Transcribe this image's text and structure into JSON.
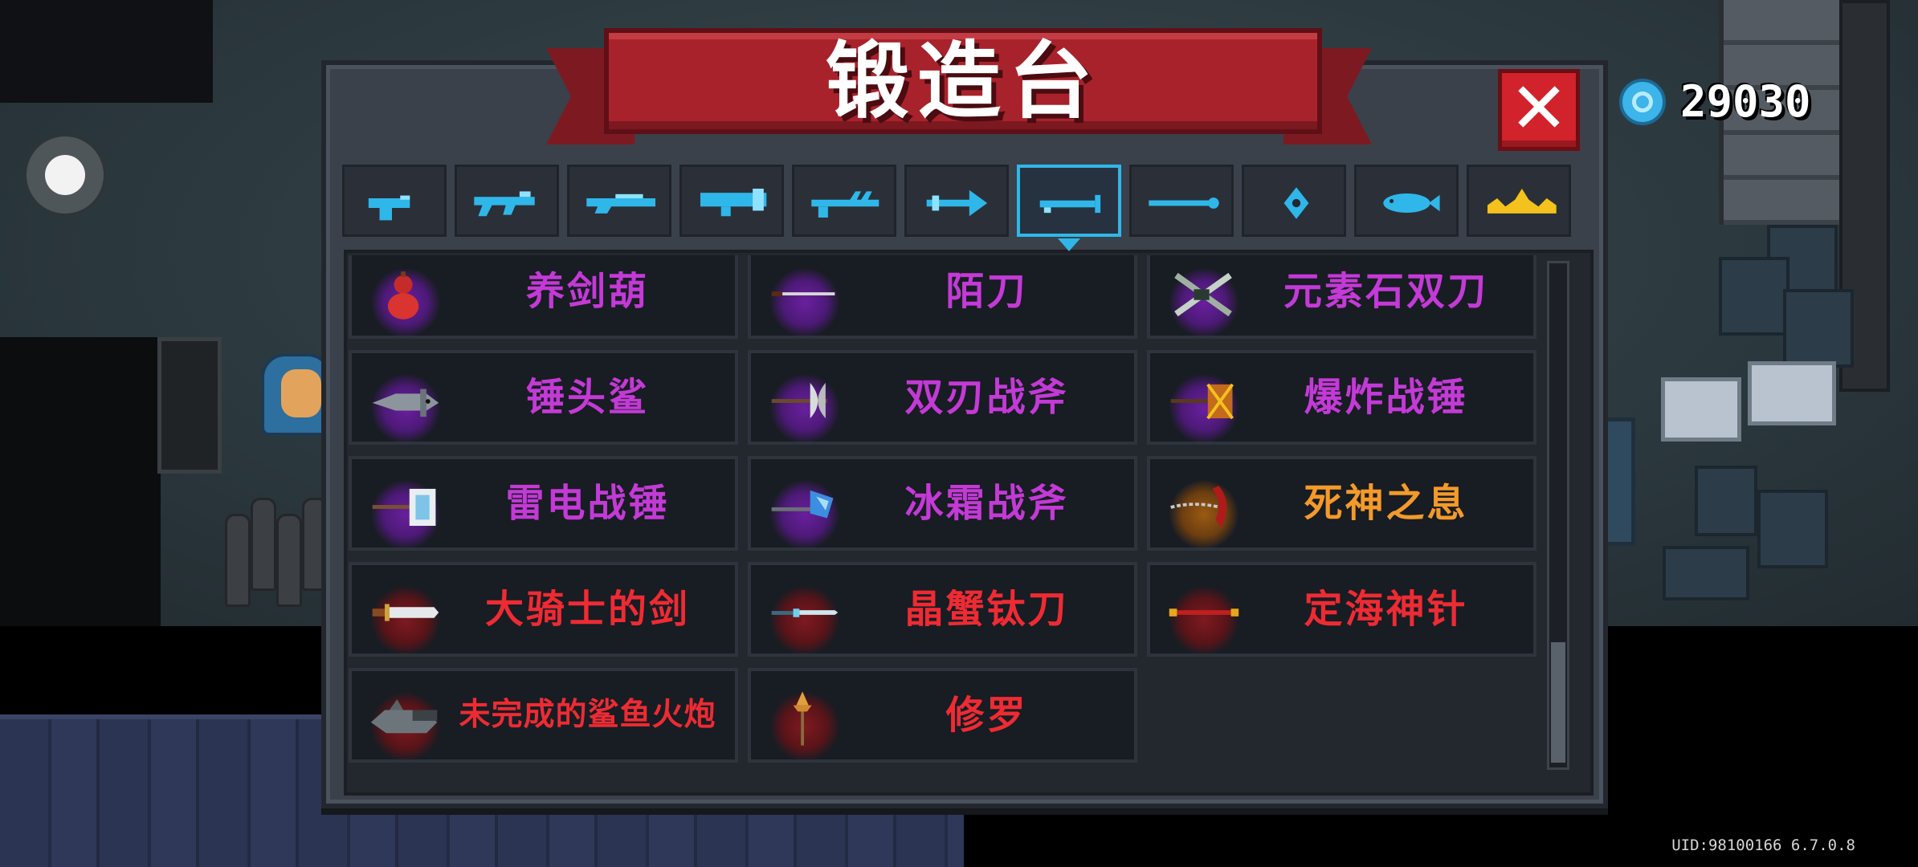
{
  "app": {
    "title": "锻造台",
    "uid_text": "UID:98100166 6.7.0.8"
  },
  "currency": {
    "icon": "gem-icon",
    "value": "29030",
    "color": "#3db4ea"
  },
  "controls": {
    "close_icon": "close-icon",
    "close_label": "✕",
    "joystick": "virtual-joystick"
  },
  "tabs": [
    {
      "icon": "pistol-icon",
      "active": false
    },
    {
      "icon": "assault-rifle-icon",
      "active": false
    },
    {
      "icon": "shotgun-icon",
      "active": false
    },
    {
      "icon": "launcher-icon",
      "active": false
    },
    {
      "icon": "laser-gun-icon",
      "active": false
    },
    {
      "icon": "bow-icon",
      "active": false
    },
    {
      "icon": "melee-sword-icon",
      "active": true
    },
    {
      "icon": "staff-icon",
      "active": false
    },
    {
      "icon": "throwable-icon",
      "active": false
    },
    {
      "icon": "fish-icon",
      "active": false
    },
    {
      "icon": "special-crown-icon",
      "active": false
    }
  ],
  "weapons": [
    {
      "name": "养剑葫",
      "tier": "purple",
      "icon": "gourd-icon"
    },
    {
      "name": "陌刀",
      "tier": "purple",
      "icon": "long-blade-icon"
    },
    {
      "name": "元素石双刀",
      "tier": "purple",
      "icon": "twin-blades-icon"
    },
    {
      "name": "锤头鲨",
      "tier": "purple",
      "icon": "hammerhead-icon"
    },
    {
      "name": "双刃战斧",
      "tier": "purple",
      "icon": "double-axe-icon"
    },
    {
      "name": "爆炸战锤",
      "tier": "purple",
      "icon": "explosive-hammer-icon"
    },
    {
      "name": "雷电战锤",
      "tier": "purple",
      "icon": "thunder-hammer-icon"
    },
    {
      "name": "冰霜战斧",
      "tier": "purple",
      "icon": "frost-axe-icon"
    },
    {
      "name": "死神之息",
      "tier": "orange",
      "icon": "scythe-icon"
    },
    {
      "name": "大骑士的剑",
      "tier": "red",
      "icon": "knight-sword-icon"
    },
    {
      "name": "晶蟹钛刀",
      "tier": "red",
      "icon": "crystal-crab-blade-icon"
    },
    {
      "name": "定海神针",
      "tier": "red",
      "icon": "golden-staff-icon"
    },
    {
      "name": "未完成的鲨鱼火炮",
      "tier": "red",
      "icon": "shark-cannon-icon"
    },
    {
      "name": "修罗",
      "tier": "red",
      "icon": "halberd-icon"
    }
  ],
  "tier_colors": {
    "purple": "#c33ad6",
    "orange": "#f39a2a",
    "red": "#ee2b33"
  }
}
